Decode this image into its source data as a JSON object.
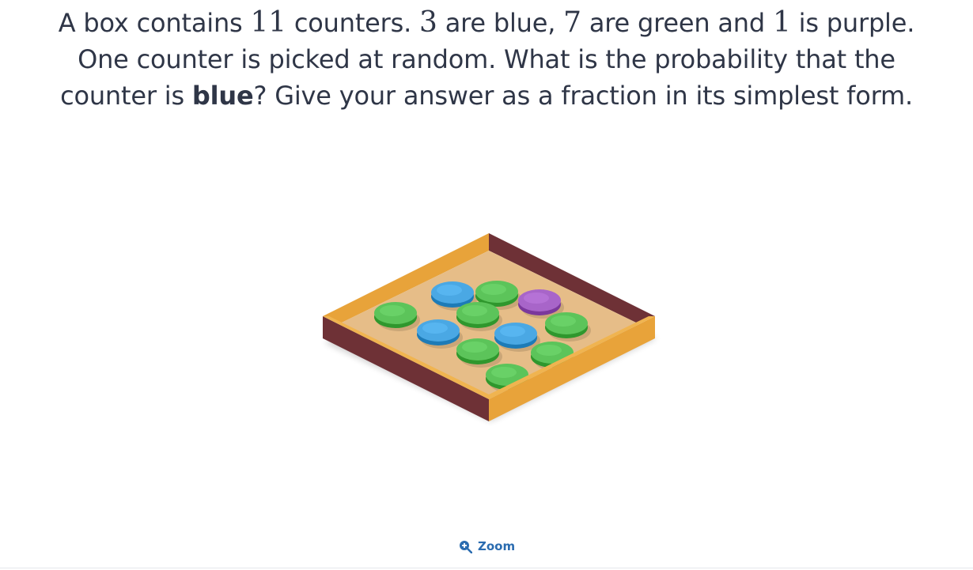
{
  "question": {
    "l1_a": "A box contains ",
    "l1_n1": "11",
    "l1_b": " counters. ",
    "l1_n2": "3",
    "l1_c": " are blue, ",
    "l1_n3": "7",
    "l1_d": " are green and ",
    "l1_n4": "1",
    "l1_e": " is purple.",
    "l2": "One counter is picked at random. What is the probability that the",
    "l3_a": "counter is ",
    "l3_bold": "blue",
    "l3_b": "? Give your answer as a fraction in its simplest form."
  },
  "figure": {
    "counters": [
      {
        "color": "green"
      },
      {
        "color": "blue"
      },
      {
        "color": "green"
      },
      {
        "color": "purple"
      },
      {
        "color": "blue"
      },
      {
        "color": "green"
      },
      {
        "color": "blue"
      },
      {
        "color": "green"
      },
      {
        "color": "green"
      },
      {
        "color": "green"
      },
      {
        "color": "green"
      }
    ],
    "colors": {
      "green": "#5cc45a",
      "blue": "#4aa8e4",
      "purple": "#a865c9",
      "box_floor": "#e6bd88",
      "box_wall_light": "#e8a33a",
      "box_wall_dark": "#6e3136"
    }
  },
  "zoom": {
    "label": "Zoom",
    "icon": "zoom-in-icon",
    "color": "#2b6cb0"
  }
}
